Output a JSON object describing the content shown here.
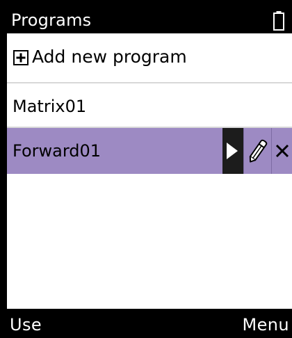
{
  "titlebar": {
    "title": "Programs",
    "battery_icon": "battery-icon"
  },
  "add_program": {
    "icon": "plus-box-icon",
    "label": "Add new program"
  },
  "programs": [
    {
      "name": "Matrix01",
      "selected": false
    },
    {
      "name": "Forward01",
      "selected": true
    }
  ],
  "row_actions": {
    "run_icon": "play-icon",
    "edit_icon": "pencil-icon",
    "delete_icon": "close-icon"
  },
  "softkeys": {
    "left": "Use",
    "right": "Menu"
  },
  "colors": {
    "selection": "#9d8ac3",
    "bars": "#000000",
    "background": "#ffffff"
  }
}
